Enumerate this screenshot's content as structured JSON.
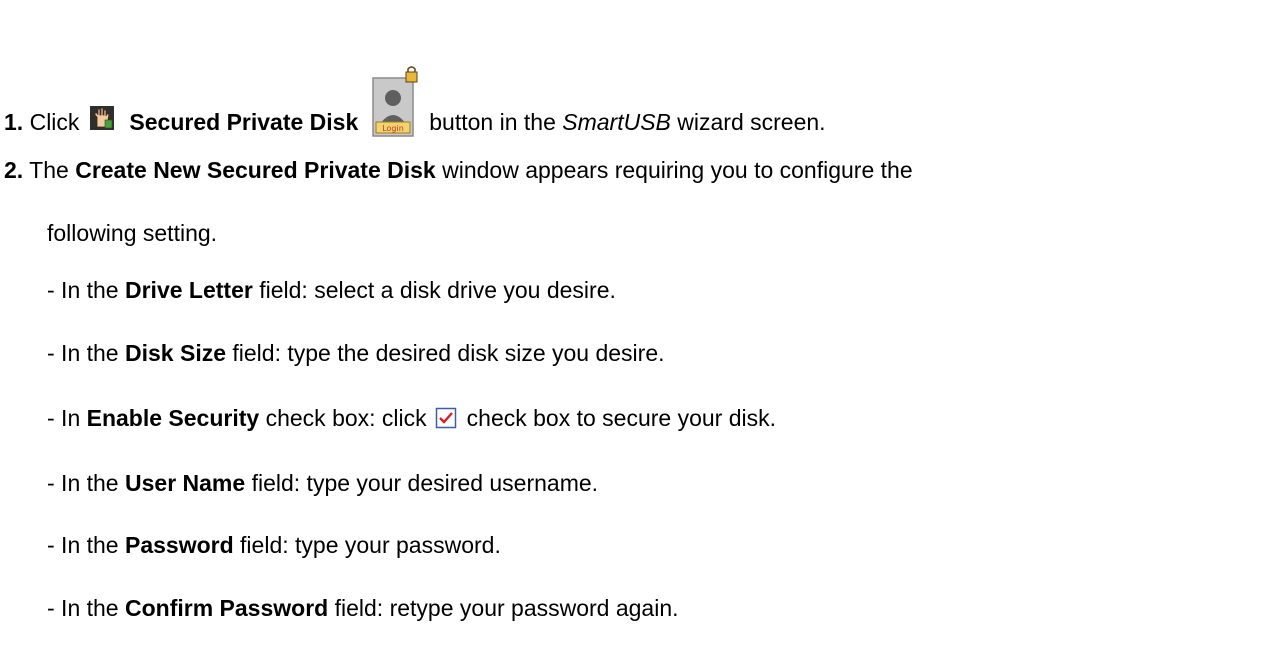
{
  "step1": {
    "number": "1.",
    "text_before": "Click",
    "button_name": "Secured Private Disk",
    "text_after": "button in the",
    "app_name": "SmartUSB",
    "text_end": "wizard screen.",
    "login_label": "Login"
  },
  "step2": {
    "number": "2.",
    "text_before": "The",
    "window_name": "Create New Secured Private Disk",
    "text_after": "window appears requiring you to configure the",
    "text_cont": "following setting."
  },
  "bullets": [
    {
      "pre": "- In the",
      "field": "Drive Letter",
      "post": "field: select a disk drive you desire."
    },
    {
      "pre": "- In the",
      "field": "Disk Size",
      "post": "field: type the desired disk size you desire."
    },
    {
      "pre": "- In",
      "field": "Enable Security",
      "mid": "check box: click",
      "post": "check box to secure your disk."
    },
    {
      "pre": "- In the",
      "field": "User Name",
      "post": "field: type your desired username."
    },
    {
      "pre": "- In the",
      "field": "Password",
      "post": "field: type your password."
    },
    {
      "pre": "- In the",
      "field": "Confirm Password",
      "post": "field: retype your password again."
    }
  ],
  "colors": {
    "text": "#000000",
    "checkbox_border": "#3b5ea8",
    "checkmark": "#d81f26",
    "login_label_bg": "#f3d36b",
    "login_label_text": "#c0392b"
  },
  "icons": [
    "hand-icon",
    "login-button-icon",
    "checkbox-checked-icon"
  ]
}
